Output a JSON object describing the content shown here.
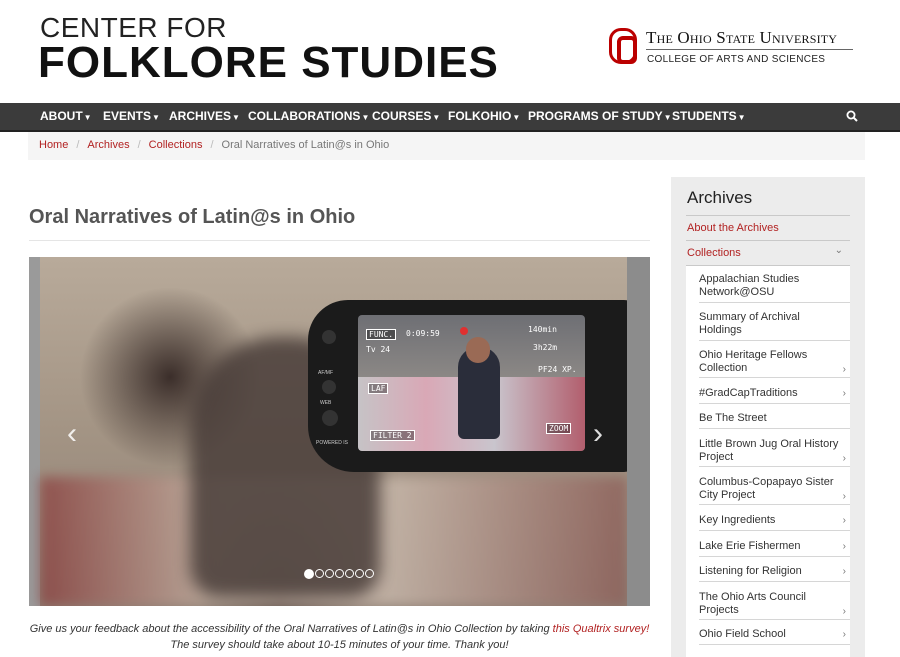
{
  "header": {
    "logo_line1": "CENTER FOR",
    "logo_line2": "FOLKLORE STUDIES",
    "osu_name": "The Ohio State University",
    "osu_sub": "COLLEGE OF ARTS AND SCIENCES",
    "brand_color": "#bb0000"
  },
  "nav": {
    "items": [
      {
        "label": "ABOUT"
      },
      {
        "label": "EVENTS"
      },
      {
        "label": "ARCHIVES"
      },
      {
        "label": "COLLABORATIONS"
      },
      {
        "label": "COURSES"
      },
      {
        "label": "FOLKOHIO"
      },
      {
        "label": "PROGRAMS OF STUDY"
      },
      {
        "label": "STUDENTS"
      }
    ],
    "search_icon": "search-icon",
    "background": "#3b3b3b"
  },
  "breadcrumb": {
    "items": [
      "Home",
      "Archives",
      "Collections"
    ],
    "current": "Oral Narratives of Latin@s in Ohio"
  },
  "main": {
    "title": "Oral Narratives of Latin@s in Ohio",
    "camera_screen": {
      "func": "FUNC.",
      "time": "0:09:59",
      "tv": "Tv 24",
      "minutes": "140min",
      "remaining": "3h22m",
      "mode": "PF24 XP.",
      "laf": "LAF",
      "filter": "FILTER 2",
      "zoom": "ZOOM"
    },
    "camera_labels": {
      "afmf": "AF/MF",
      "web": "WEB",
      "powered": "POWERED IS"
    },
    "carousel": {
      "prev_icon": "chevron-left-icon",
      "next_icon": "chevron-right-icon",
      "slide_count": 7,
      "active_index": 0
    },
    "caption": {
      "before": "Give us your feedback about the accessibility of the Oral Narratives of Latin@s in Ohio Collection by taking ",
      "link": "this Qualtrix survey!",
      "after": " The survey should take about 10-15 minutes of your time. Thank you!"
    },
    "link_color": "#b22222"
  },
  "sidebar": {
    "title": "Archives",
    "links": [
      "About the Archives",
      "Collections"
    ],
    "collections_toggle_icon": "chevron-down-icon",
    "items": [
      {
        "label": "Appalachian Studies Network@OSU",
        "chevron": false
      },
      {
        "label": "Summary of Archival Holdings",
        "chevron": false
      },
      {
        "label": "Ohio Heritage Fellows Collection",
        "chevron": true
      },
      {
        "label": "#GradCapTraditions",
        "chevron": true
      },
      {
        "label": "Be The Street",
        "chevron": false
      },
      {
        "label": "Little Brown Jug Oral History Project",
        "chevron": true
      },
      {
        "label": "Columbus-Copapayo Sister City Project",
        "chevron": true
      },
      {
        "label": "Key Ingredients",
        "chevron": true
      },
      {
        "label": "Lake Erie Fishermen",
        "chevron": true
      },
      {
        "label": "Listening for Religion",
        "chevron": true
      },
      {
        "label": "The Ohio Arts Council Projects",
        "chevron": true
      },
      {
        "label": "Ohio Field School",
        "chevron": true
      }
    ],
    "chevron_glyph": "›",
    "down_glyph": "⌄"
  }
}
